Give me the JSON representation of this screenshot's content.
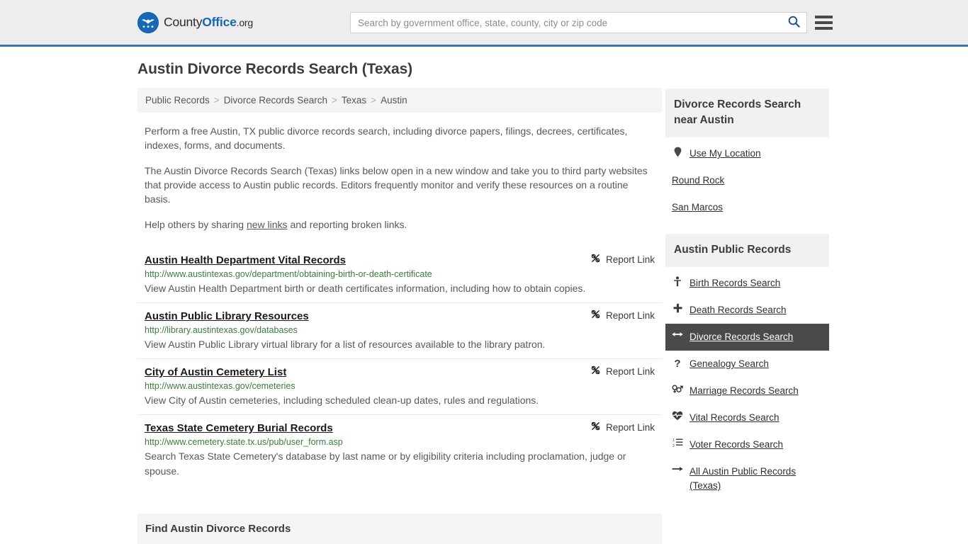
{
  "header": {
    "logo": {
      "part1": "County",
      "part2": "Office",
      "part3": ".org",
      "icon": "eagle-shield-logo-icon"
    },
    "search": {
      "placeholder": "Search by government office, state, county, city or zip code",
      "value": "",
      "icon": "search-icon"
    },
    "menu_icon": "hamburger-menu-icon",
    "accent_color": "#3b74a8",
    "background_color": "#eeecec"
  },
  "main": {
    "title": "Austin Divorce Records Search (Texas)",
    "breadcrumb": [
      {
        "label": "Public Records"
      },
      {
        "label": "Divorce Records Search"
      },
      {
        "label": "Texas"
      },
      {
        "label": "Austin"
      }
    ],
    "breadcrumb_separator": ">",
    "intro": {
      "paragraph1": "Perform a free Austin, TX public divorce records search, including divorce papers, filings, decrees, certificates, indexes, forms, and documents.",
      "paragraph2": "The Austin Divorce Records Search (Texas) links below open in a new window and take you to third party websites that provide access to Austin public records. Editors frequently monitor and verify these resources on a routine basis.",
      "paragraph3_before": "Help others by sharing ",
      "paragraph3_link": "new links",
      "paragraph3_after": " and reporting broken links."
    },
    "report_link_label": "Report Link",
    "report_link_icon": "broken-link-icon",
    "results": [
      {
        "title": "Austin Health Department Vital Records",
        "url": "http://www.austintexas.gov/department/obtaining-birth-or-death-certificate",
        "description": "View Austin Health Department birth or death certificates information, including how to obtain copies."
      },
      {
        "title": "Austin Public Library Resources",
        "url": "http://library.austintexas.gov/databases",
        "description": "View Austin Public Library virtual library for a list of resources available to the library patron."
      },
      {
        "title": "City of Austin Cemetery List",
        "url": "http://www.austintexas.gov/cemeteries",
        "description": "View City of Austin cemeteries, including scheduled clean-up dates, rules and regulations."
      },
      {
        "title": "Texas State Cemetery Burial Records",
        "url": "http://www.cemetery.state.tx.us/pub/user_form.asp",
        "description": "Search Texas State Cemetery's database by last name or by eligibility criteria including proclamation, judge or spouse."
      }
    ],
    "find_section_title": "Find Austin Divorce Records"
  },
  "sidebar": {
    "near_panel": {
      "title": "Divorce Records Search near Austin",
      "items": [
        {
          "label": "Use My Location",
          "icon": "map-pin-icon"
        },
        {
          "label": "Round Rock",
          "icon": ""
        },
        {
          "label": "San Marcos",
          "icon": ""
        }
      ]
    },
    "records_panel": {
      "title": "Austin Public Records",
      "active_color": "#4a4a4a",
      "items": [
        {
          "label": "Birth Records Search",
          "icon": "baby-icon",
          "glyph": "Ɔ",
          "active": false
        },
        {
          "label": "Death Records Search",
          "icon": "cross-icon",
          "glyph": "✚",
          "active": false
        },
        {
          "label": "Divorce Records Search",
          "icon": "left-right-arrow-icon",
          "glyph": "↔",
          "active": true
        },
        {
          "label": "Genealogy Search",
          "icon": "question-mark-icon",
          "glyph": "?",
          "active": false
        },
        {
          "label": "Marriage Records Search",
          "icon": "gender-symbols-icon",
          "glyph": "⚥",
          "active": false
        },
        {
          "label": "Vital Records Search",
          "icon": "heartbeat-icon",
          "glyph": "♥",
          "active": false
        },
        {
          "label": "Voter Records Search",
          "icon": "ordered-list-icon",
          "glyph": "≡",
          "active": false
        },
        {
          "label": "All Austin Public Records (Texas)",
          "icon": "arrow-right-icon",
          "glyph": "→",
          "active": false
        }
      ]
    }
  }
}
